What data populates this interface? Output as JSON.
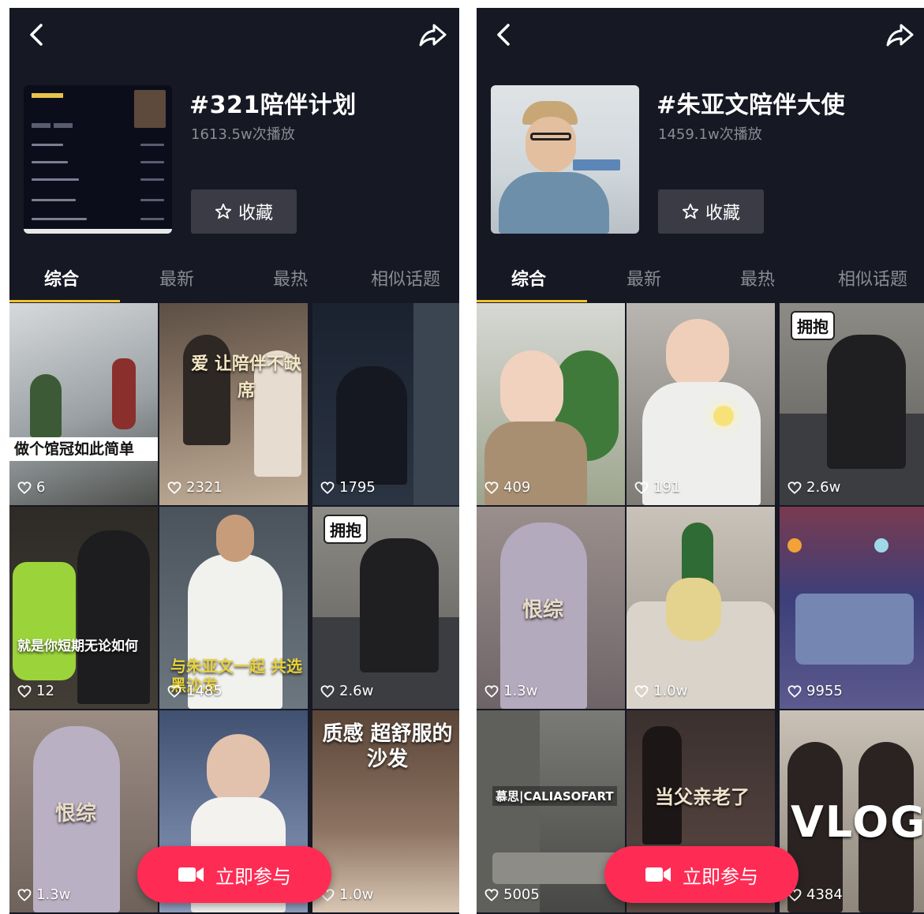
{
  "panels": [
    {
      "title": "#321陪伴计划",
      "plays": "1613.5w次播放",
      "favorite_label": "收藏",
      "tabs": [
        "综合",
        "最新",
        "最热",
        "相似话题"
      ],
      "tiles": [
        {
          "likes": "6",
          "caption": "做个馆冠如此简单",
          "bg": "#6b6f73"
        },
        {
          "likes": "2321",
          "caption": "爱 让陪伴不缺席",
          "bg": "#7d6a58"
        },
        {
          "likes": "1795",
          "caption": "",
          "bg": "#1f2630"
        },
        {
          "likes": "12",
          "caption": "就是你短期无论如何",
          "bg": "#3b3a36"
        },
        {
          "likes": "1485",
          "caption": "与朱亚文一起 共选黑沙发",
          "bg": "#58616a"
        },
        {
          "likes": "2.6w",
          "caption": "",
          "badge": "拥抱",
          "bg": "#6f6e6a"
        },
        {
          "likes": "1.3w",
          "caption": "恨综",
          "bg": "#8a7d74"
        },
        {
          "likes": "",
          "caption": "",
          "bg": "#4f5f7d"
        },
        {
          "likes": "1.0w",
          "caption": "质感 超舒服的沙发",
          "bg": "#6b574a"
        }
      ],
      "join_label": "立即参与"
    },
    {
      "title": "#朱亚文陪伴大使",
      "plays": "1459.1w次播放",
      "favorite_label": "收藏",
      "tabs": [
        "综合",
        "最新",
        "最热",
        "相似话题"
      ],
      "tiles": [
        {
          "likes": "409",
          "caption": "",
          "bg": "#5c6a4e"
        },
        {
          "likes": "191",
          "caption": "",
          "bg": "#8d8a86"
        },
        {
          "likes": "2.6w",
          "caption": "",
          "badge": "拥抱",
          "bg": "#6f6e6a"
        },
        {
          "likes": "1.3w",
          "caption": "恨综",
          "bg": "#7b6e70"
        },
        {
          "likes": "1.0w",
          "caption": "",
          "bg": "#a59a8d"
        },
        {
          "likes": "9955",
          "caption": "",
          "bg": "#4b3f6d"
        },
        {
          "likes": "5005",
          "caption": "慕思|CALIASOFART",
          "bg": "#51514f"
        },
        {
          "likes": "",
          "caption": "当父亲老了",
          "bg": "#4a3d3a"
        },
        {
          "likes": "4384",
          "caption": "VLOG",
          "bg": "#b9b1a8"
        }
      ],
      "join_label": "立即参与"
    }
  ],
  "icons": {
    "back": "chevron-left-icon",
    "share": "share-arrow-icon",
    "favorite": "star-outline-icon",
    "like": "heart-outline-icon",
    "join": "video-camera-icon"
  },
  "colors": {
    "background": "#161823",
    "accent": "#fe2c55",
    "tab_underline": "#f2c230"
  }
}
